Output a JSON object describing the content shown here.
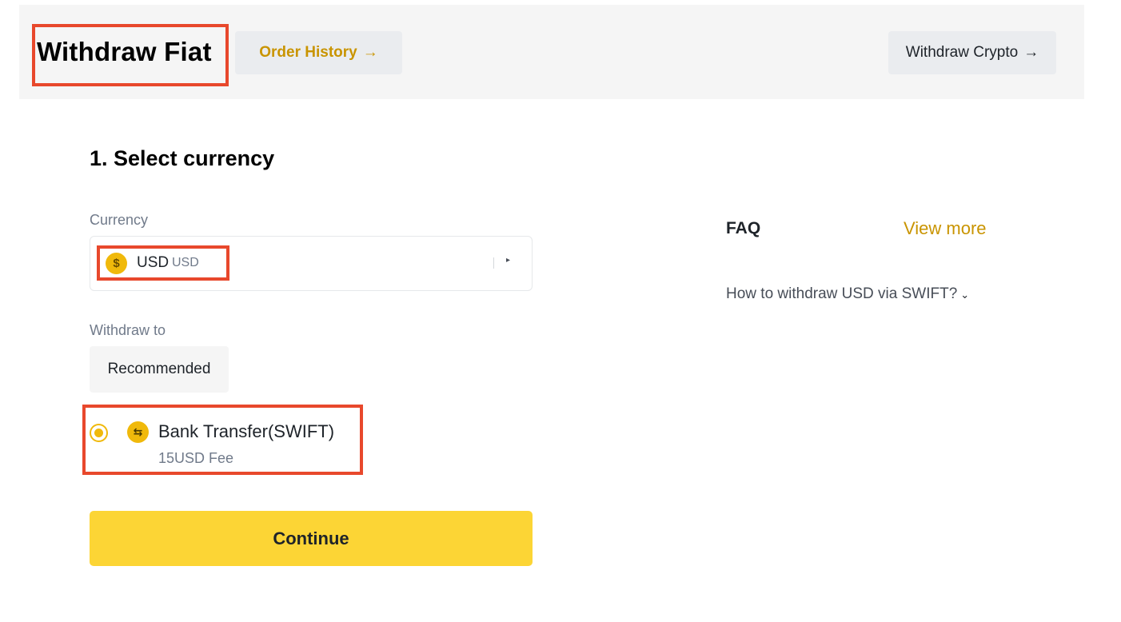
{
  "header": {
    "title": "Withdraw Fiat",
    "order_history_label": "Order History",
    "withdraw_crypto_label": "Withdraw Crypto",
    "arrow_glyph": "→"
  },
  "form": {
    "section_title": "1. Select currency",
    "currency_label": "Currency",
    "currency": {
      "icon_glyph": "$",
      "code": "USD",
      "sub_code": "USD",
      "caret_glyph": "▸"
    },
    "withdraw_to_label": "Withdraw to",
    "recommended_tab": "Recommended",
    "method": {
      "icon_glyph": "⇆",
      "title": "Bank Transfer(SWIFT)",
      "fee": "15USD Fee",
      "selected": true
    },
    "continue_label": "Continue"
  },
  "faq": {
    "title": "FAQ",
    "view_more_label": "View more",
    "items": [
      {
        "question": "How to withdraw USD via SWIFT?",
        "chevron_glyph": "⌄"
      }
    ]
  },
  "colors": {
    "accent_yellow": "#fcd535",
    "link_gold": "#c99400",
    "highlight_red": "#e8482c"
  }
}
